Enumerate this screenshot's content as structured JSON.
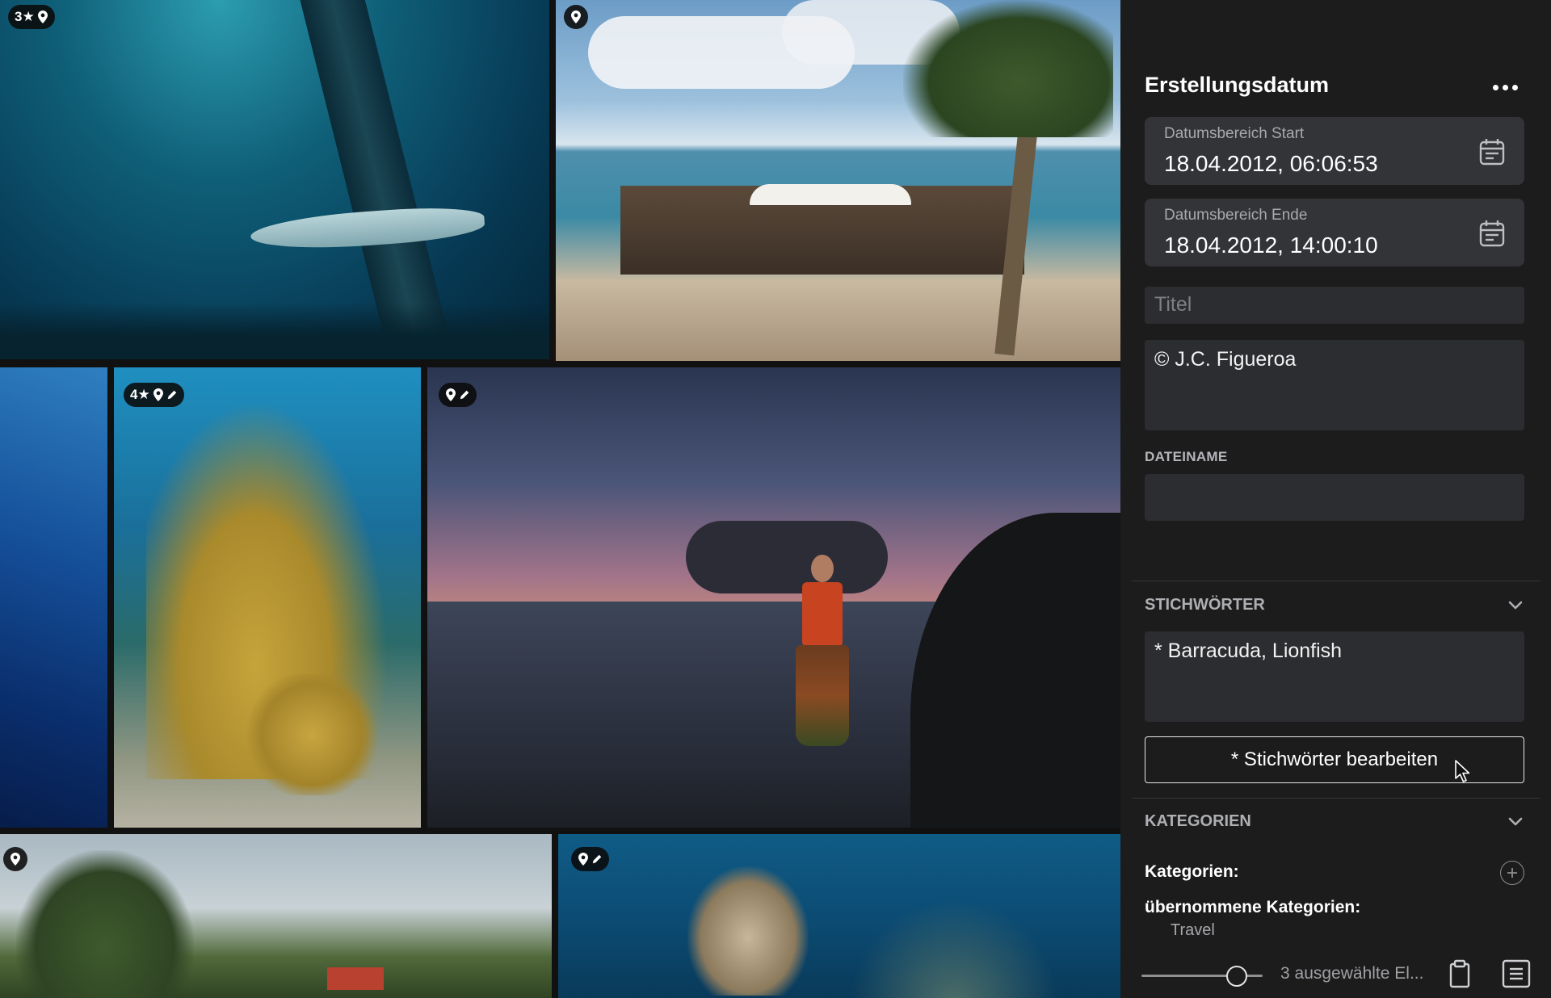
{
  "photos": [
    {
      "id": "p1",
      "badge": "3★",
      "has_location": true,
      "has_edit": false,
      "selected": true
    },
    {
      "id": "p2",
      "badge": "",
      "has_location": true,
      "has_edit": false,
      "selected": false
    },
    {
      "id": "p3",
      "badge": "",
      "has_location": false,
      "has_edit": false,
      "selected": false
    },
    {
      "id": "p4",
      "badge": "4★",
      "has_location": true,
      "has_edit": true,
      "selected": true
    },
    {
      "id": "p5",
      "badge": "",
      "has_location": true,
      "has_edit": true,
      "selected": false
    },
    {
      "id": "p6",
      "badge": "",
      "has_location": true,
      "has_edit": false,
      "selected": false
    },
    {
      "id": "p7",
      "badge": "",
      "has_location": true,
      "has_edit": true,
      "selected": false
    }
  ],
  "inspector": {
    "title": "Erstellungsdatum",
    "date_start": {
      "label": "Datumsbereich Start",
      "value": "18.04.2012, 06:06:53"
    },
    "date_end": {
      "label": "Datumsbereich Ende",
      "value": "18.04.2012, 14:00:10"
    },
    "title_field": {
      "placeholder": "Titel",
      "value": ""
    },
    "description_field": {
      "value": "© J.C. Figueroa"
    },
    "filename": {
      "label": "DATEINAME",
      "value": ""
    },
    "keywords": {
      "header": "STICHWÖRTER",
      "value": "* Barracuda, Lionfish",
      "edit_button": "* Stichwörter bearbeiten"
    },
    "categories": {
      "header": "KATEGORIEN",
      "label": "Kategorien:",
      "inherited_label": "übernommene Kategorien:",
      "inherited_value": "Travel"
    },
    "footer": {
      "selection_text": "3 ausgewählte El...",
      "zoom_level": 0.85
    }
  },
  "colors": {
    "selection": "#2aa9ee",
    "panel_bg": "#1c1c1c",
    "field_bg": "#333438"
  }
}
